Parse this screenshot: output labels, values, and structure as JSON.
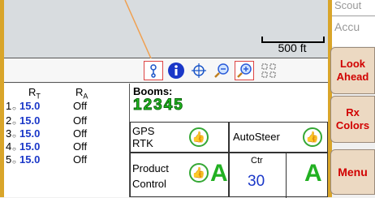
{
  "map": {
    "scale_label": "500 ft"
  },
  "right_panel": {
    "scout": "Scout",
    "accu": "Accu",
    "look_ahead": "Look Ahead",
    "rx_colors": "Rx Colors",
    "menu": "Menu"
  },
  "toolbar": {
    "icons": [
      "pin-icon",
      "info-icon",
      "crosshair-icon",
      "zoom-out-icon",
      "zoom-in-icon",
      "grid-icon"
    ]
  },
  "rates": {
    "header_rt": "R",
    "header_rt_sub": "T",
    "header_ra": "R",
    "header_ra_sub": "A",
    "rows": [
      {
        "num": "1",
        "rt": "15.0",
        "ra": "Off"
      },
      {
        "num": "2",
        "rt": "15.0",
        "ra": "Off"
      },
      {
        "num": "3",
        "rt": "15.0",
        "ra": "Off"
      },
      {
        "num": "4",
        "rt": "15.0",
        "ra": "Off"
      },
      {
        "num": "5",
        "rt": "15.0",
        "ra": "Off"
      }
    ]
  },
  "booms": {
    "label": "Booms:",
    "digits": "12345",
    "gps_label": "GPS",
    "rtk_label": "RTK",
    "autosteer_label": "AutoSteer",
    "product_label": "Product",
    "control_label": "Control",
    "a_left": "A",
    "ctr_label": "Ctr",
    "ctr_value": "30",
    "a_right": "A"
  },
  "colors": {
    "frame": "#d9a52a",
    "rate_value": "#1a37c8",
    "alert_text": "#d10000",
    "status_green": "#22c022"
  }
}
